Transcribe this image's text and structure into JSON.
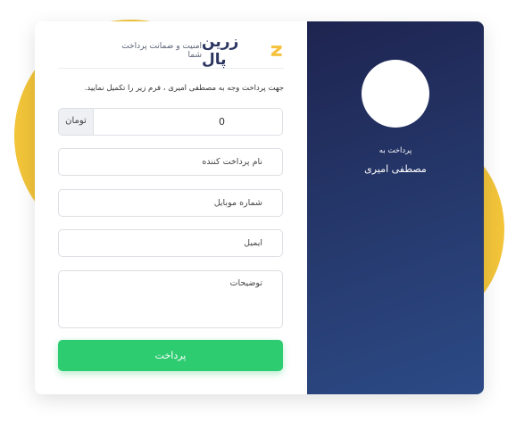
{
  "header": {
    "brand_name": "زرین پال",
    "tagline": "امنیت و ضمانت پرداخت شما"
  },
  "form": {
    "instruction": "جهت پرداخت وجه به مصطفی امیری ، فرم زیر را تکمیل نمایید.",
    "amount_value": "0",
    "currency_label": "تومان",
    "name_placeholder": "نام پرداخت کننده",
    "mobile_placeholder": "شماره موبایل",
    "email_placeholder": "ایمیل",
    "description_placeholder": "توضیحات",
    "submit_label": "پرداخت"
  },
  "side": {
    "pay_to_label": "پرداخت به",
    "recipient_name": "مصطفی امیری"
  },
  "colors": {
    "accent_yellow": "#f2c43a",
    "panel_navy": "#1e2450",
    "button_green": "#2ecc71",
    "logo_yellow": "#f6c23e"
  },
  "icons": {
    "brand_logo": "zarinpal-logo-icon"
  }
}
